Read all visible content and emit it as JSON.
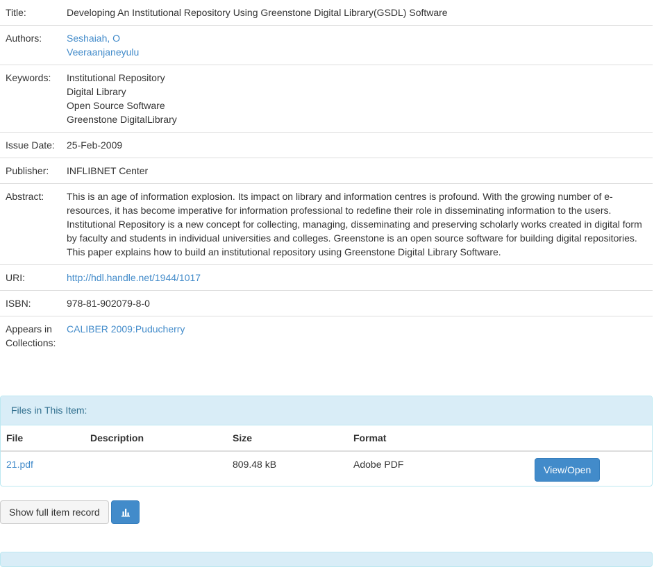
{
  "metadata": [
    {
      "key": "title",
      "label": "Title:",
      "values": [
        "Developing An Institutional Repository Using Greenstone Digital Library(GSDL) Software"
      ],
      "link": false
    },
    {
      "key": "authors",
      "label": "Authors:",
      "values": [
        "Seshaiah, O",
        "Veeraanjaneyulu"
      ],
      "link": true
    },
    {
      "key": "keywords",
      "label": "Keywords:",
      "values": [
        "Institutional Repository",
        "Digital Library",
        "Open Source Software",
        "Greenstone DigitalLibrary"
      ],
      "link": false
    },
    {
      "key": "issue-date",
      "label": "Issue Date:",
      "values": [
        "25-Feb-2009"
      ],
      "link": false
    },
    {
      "key": "publisher",
      "label": "Publisher:",
      "values": [
        "INFLIBNET Center"
      ],
      "link": false
    },
    {
      "key": "abstract",
      "label": "Abstract:",
      "values": [
        "This is an age of information explosion. Its impact on library and information centres is profound. With the growing number of e-resources, it has become imperative for information professional to redefine their role in disseminating information to the users. Institutional Repository is a new concept for collecting, managing, disseminating and preserving scholarly works created in digital form by faculty and students in individual universities and colleges. Greenstone is an open source software for building digital repositories. This paper explains how to build an institutional repository using Greenstone Digital Library Software."
      ],
      "link": false
    },
    {
      "key": "uri",
      "label": "URI:",
      "values": [
        "http://hdl.handle.net/1944/1017"
      ],
      "link": true
    },
    {
      "key": "isbn",
      "label": "ISBN:",
      "values": [
        "978-81-902079-8-0"
      ],
      "link": false
    },
    {
      "key": "collections",
      "label": "Appears in Collections:",
      "values": [
        "CALIBER 2009:Puducherry"
      ],
      "link": true
    }
  ],
  "files": {
    "heading": "Files in This Item:",
    "columns": {
      "file": "File",
      "description": "Description",
      "size": "Size",
      "format": "Format"
    },
    "rows": [
      {
        "file": "21.pdf",
        "description": "",
        "size": "809.48 kB",
        "format": "Adobe PDF",
        "action": "View/Open"
      }
    ]
  },
  "actions": {
    "full_record": "Show full item record",
    "stats_icon": "bar-chart-icon"
  },
  "colors": {
    "link": "#428bca",
    "primary": "#428bca",
    "panel_bg": "#d9edf7",
    "panel_border": "#bce8f1",
    "panel_text": "#31708f"
  }
}
